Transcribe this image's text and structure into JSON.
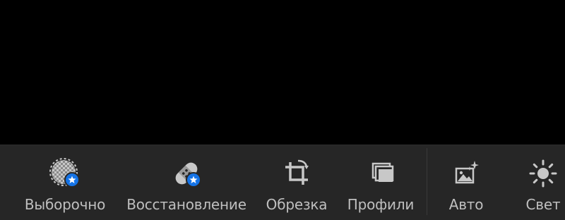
{
  "colors": {
    "background": "#000000",
    "toolbar_background": "#262626",
    "label": "#bfbfbf",
    "icon": "#c8c8c8",
    "premium_badge": "#1473e6"
  },
  "toolbar": {
    "tools": [
      {
        "label": "Выборочно",
        "icon": "selective-icon",
        "premium": true
      },
      {
        "label": "Восстановление",
        "icon": "healing-bandage-icon",
        "premium": true
      },
      {
        "label": "Обрезка",
        "icon": "crop-rotate-icon",
        "premium": false
      },
      {
        "label": "Профили",
        "icon": "profiles-icon",
        "premium": false
      },
      {
        "label": "Авто",
        "icon": "auto-image-icon",
        "premium": false
      },
      {
        "label": "Свет",
        "icon": "light-sun-icon",
        "premium": false
      }
    ]
  }
}
